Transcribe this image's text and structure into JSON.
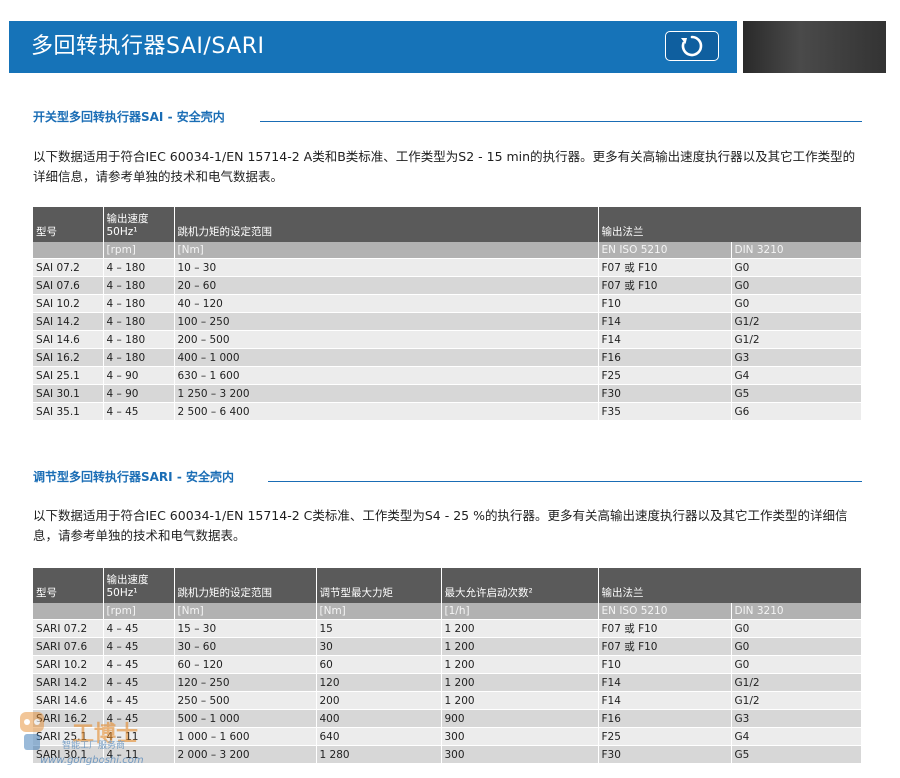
{
  "header": {
    "title": "多回转执行器SAI/SARI"
  },
  "sai": {
    "title": "开关型多回转执行器SAI - 安全壳内",
    "para": "以下数据适用于符合IEC 60034-1/EN 15714-2 A类和B类标准、工作类型为S2 - 15 min的执行器。更多有关高输出速度执行器以及其它工作类型的详细信息，请参考单独的技术和电气数据表。",
    "headers": {
      "type": "型号",
      "speed": "输出速度",
      "speed_sub": "50Hz¹",
      "torque": "跳机力矩的设定范围",
      "flange": "输出法兰"
    },
    "units": [
      "",
      "[rpm]",
      "[Nm]",
      "EN ISO 5210",
      "DIN 3210"
    ],
    "rows": [
      [
        "SAI 07.2",
        "4 – 180",
        "10 – 30",
        "F07 或 F10",
        "G0"
      ],
      [
        "SAI 07.6",
        "4 – 180",
        "20 – 60",
        "F07 或 F10",
        "G0"
      ],
      [
        "SAI 10.2",
        "4 – 180",
        "40 – 120",
        "F10",
        "G0"
      ],
      [
        "SAI 14.2",
        "4 – 180",
        "100 – 250",
        "F14",
        "G1/2"
      ],
      [
        "SAI 14.6",
        "4 – 180",
        "200 – 500",
        "F14",
        "G1/2"
      ],
      [
        "SAI 16.2",
        "4 – 180",
        "400 – 1 000",
        "F16",
        "G3"
      ],
      [
        "SAI 25.1",
        "4 – 90",
        "630 – 1 600",
        "F25",
        "G4"
      ],
      [
        "SAI 30.1",
        "4 – 90",
        "1 250 – 3 200",
        "F30",
        "G5"
      ],
      [
        "SAI 35.1",
        "4 – 45",
        "2 500 – 6 400",
        "F35",
        "G6"
      ]
    ]
  },
  "sari": {
    "title": "调节型多回转执行器SARI - 安全壳内",
    "para": "以下数据适用于符合IEC 60034-1/EN 15714-2 C类标准、工作类型为S4 - 25 %的执行器。更多有关高输出速度执行器以及其它工作类型的详细信息，请参考单独的技术和电气数据表。",
    "headers": {
      "type": "型号",
      "speed": "输出速度",
      "speed_sub": "50Hz¹",
      "torque": "跳机力矩的设定范围",
      "mod_torque": "调节型最大力矩",
      "starts": "最大允许启动次数²",
      "flange": "输出法兰"
    },
    "units": [
      "",
      "[rpm]",
      "[Nm]",
      "[Nm]",
      "[1/h]",
      "EN ISO 5210",
      "DIN 3210"
    ],
    "rows": [
      [
        "SARI 07.2",
        "4 – 45",
        "15 – 30",
        "15",
        "1 200",
        "F07 或 F10",
        "G0"
      ],
      [
        "SARI 07.6",
        "4 – 45",
        "30 – 60",
        "30",
        "1 200",
        "F07 或 F10",
        "G0"
      ],
      [
        "SARI 10.2",
        "4 – 45",
        "60 – 120",
        "60",
        "1 200",
        "F10",
        "G0"
      ],
      [
        "SARI 14.2",
        "4 – 45",
        "120 – 250",
        "120",
        "1 200",
        "F14",
        "G1/2"
      ],
      [
        "SARI 14.6",
        "4 – 45",
        "250 – 500",
        "200",
        "1 200",
        "F14",
        "G1/2"
      ],
      [
        "SARI 16.2",
        "4 – 45",
        "500 – 1 000",
        "400",
        "900",
        "F16",
        "G3"
      ],
      [
        "SARI 25.1",
        "4 – 11",
        "1 000 – 1 600",
        "640",
        "300",
        "F25",
        "G4"
      ],
      [
        "SARI 30.1",
        "4 – 11",
        "2 000 – 3 200",
        "1 280",
        "300",
        "F30",
        "G5"
      ]
    ]
  },
  "watermark": {
    "brand": "工博士",
    "sub": "智能工厂服务商",
    "url": "www.gongboshi.com"
  },
  "colors": {
    "header_blue": "#1673b8",
    "section_blue": "#1a6db5",
    "table_header": "#5a5a5a"
  }
}
